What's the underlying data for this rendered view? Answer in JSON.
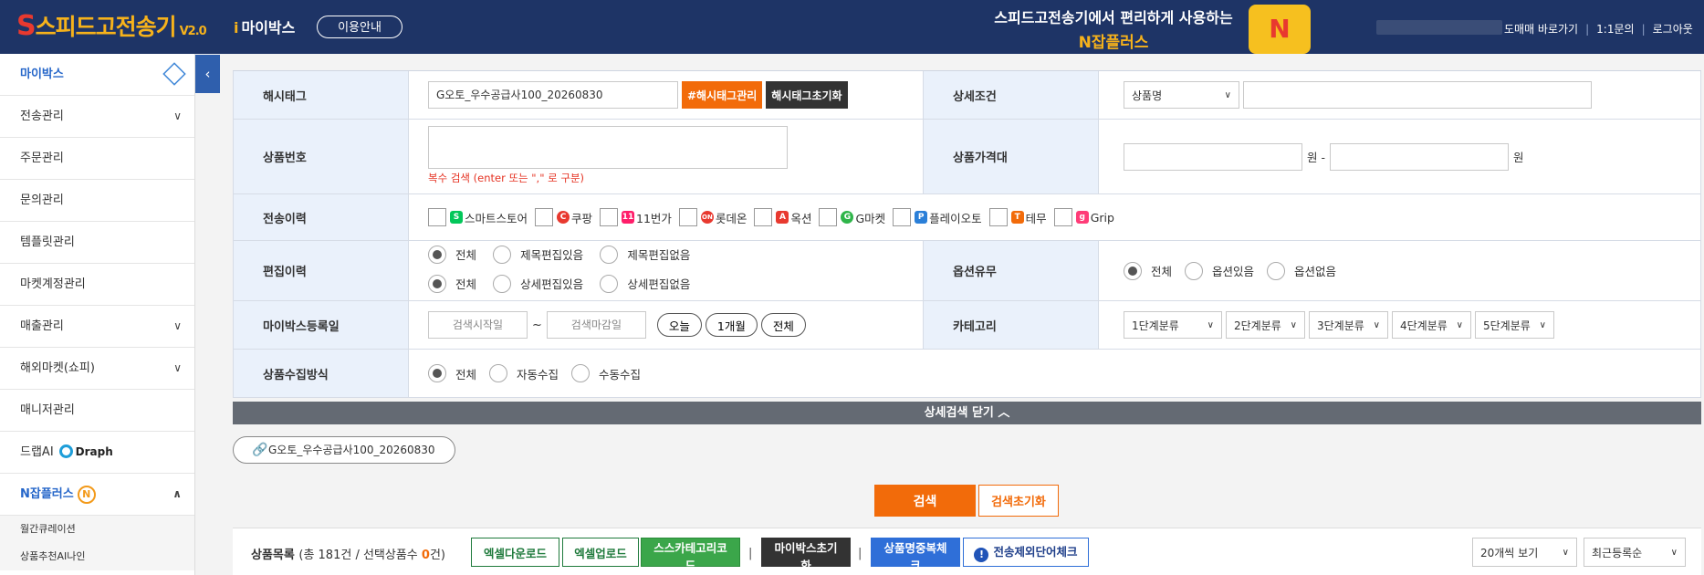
{
  "header": {
    "logo_s": "S",
    "logo_text": "스피드고전송기",
    "logo_version": "V2.0",
    "mybox_label": "마이박스",
    "guide_button": "이용안내",
    "promo_line1": "스피드고전송기에서 편리하게 사용하는",
    "promo_line2": "N잡플러스",
    "top_link_1": "도매매 바로가기",
    "top_link_2": "1:1문의",
    "top_link_3": "로그아웃"
  },
  "sidebar": {
    "items": [
      {
        "label": "마이박스"
      },
      {
        "label": "전송관리"
      },
      {
        "label": "주문관리"
      },
      {
        "label": "문의관리"
      },
      {
        "label": "템플릿관리"
      },
      {
        "label": "마켓계정관리"
      },
      {
        "label": "매출관리"
      },
      {
        "label": "해외마켓(쇼피)"
      },
      {
        "label": "매니저관리"
      },
      {
        "label": "드랩AI",
        "brand": "Draph"
      },
      {
        "label": "N잡플러스",
        "badge": "N"
      }
    ],
    "subitems": [
      "월간큐레이션",
      "상품추천AI나인"
    ]
  },
  "form": {
    "hashtag": {
      "label": "해시태그",
      "value": "G오토_우수공급사100_20260830",
      "manage_button": "#해시태그관리",
      "reset_button": "해시태그초기화"
    },
    "detail_cond": {
      "label": "상세조건",
      "select": "상품명"
    },
    "product_no": {
      "label": "상품번호",
      "hint": "복수 검색 (enter 또는 \",\" 로 구분)"
    },
    "price_range": {
      "label": "상품가격대",
      "unit1": "원 -",
      "unit2": "원"
    },
    "send_history": {
      "label": "전송이력",
      "markets": [
        {
          "icon": "S",
          "name": "스마트스토어",
          "color": "#03c75a"
        },
        {
          "icon": "C",
          "name": "쿠팡",
          "color": "#e8392f"
        },
        {
          "icon": "11",
          "name": "11번가",
          "color": "#ff1e6a"
        },
        {
          "icon": "ON",
          "name": "롯데온",
          "color": "#e8392f"
        },
        {
          "icon": "A",
          "name": "옥션",
          "color": "#e8392f"
        },
        {
          "icon": "G",
          "name": "G마켓",
          "color": "#2fb54a"
        },
        {
          "icon": "P",
          "name": "플레이오토",
          "color": "#2a7fd8"
        },
        {
          "icon": "T",
          "name": "테무",
          "color": "#f26b0a"
        },
        {
          "icon": "g",
          "name": "Grip",
          "color": "#ff3c78"
        }
      ]
    },
    "edit_history": {
      "label": "편집이력",
      "row1": [
        "전체",
        "제목편집있음",
        "제목편집없음"
      ],
      "row2": [
        "전체",
        "상세편집있음",
        "상세편집없음"
      ]
    },
    "option": {
      "label": "옵션유무",
      "choices": [
        "전체",
        "옵션있음",
        "옵션없음"
      ]
    },
    "reg_date": {
      "label": "마이박스등록일",
      "start_placeholder": "검색시작일",
      "tilde": "~",
      "end_placeholder": "검색마감일",
      "today": "오늘",
      "month": "1개월",
      "all": "전체"
    },
    "category": {
      "label": "카테고리",
      "selects": [
        "1단계분류",
        "2단계분류",
        "3단계분류",
        "4단계분류",
        "5단계분류"
      ]
    },
    "collect": {
      "label": "상품수집방식",
      "choices": [
        "전체",
        "자동수집",
        "수동수집"
      ]
    }
  },
  "close_bar": "상세검색 닫기 ︿",
  "tag_chip": "G오토_우수공급사100_20260830",
  "search_button": "검색",
  "search_reset_button": "검색초기화",
  "list": {
    "title": "상품목록",
    "count_prefix": "(총 181건 / 선택상품수 ",
    "selected": "0",
    "count_suffix": "건)",
    "excel_down": "엑셀다운로드",
    "excel_up": "엑셀업로드",
    "ssca": "스스카테고리코드",
    "mybox_reset": "마이박스초기화",
    "dup_check": "상품명중복체크",
    "exclude_check": "전송제외단어체크",
    "per_page": "20개씩 보기",
    "sort": "최근등록순"
  }
}
